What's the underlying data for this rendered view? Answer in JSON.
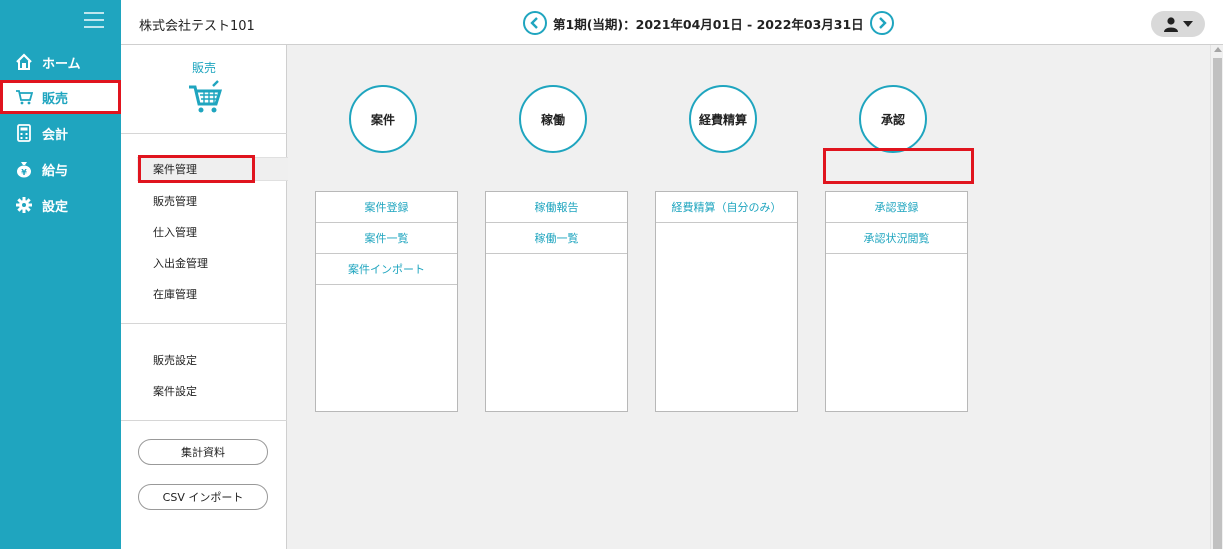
{
  "nav": {
    "items": [
      {
        "label": "ホーム",
        "icon": "home-icon"
      },
      {
        "label": "販売",
        "icon": "cart-icon"
      },
      {
        "label": "会計",
        "icon": "calculator-icon"
      },
      {
        "label": "給与",
        "icon": "money-bag-icon"
      },
      {
        "label": "設定",
        "icon": "gear-icon"
      }
    ]
  },
  "header": {
    "company": "株式会社テスト101",
    "period": "第1期(当期)：2021年04月01日 - 2022年03月31日"
  },
  "subpanel": {
    "title": "販売",
    "group1": [
      "案件管理",
      "販売管理",
      "仕入管理",
      "入出金管理",
      "在庫管理"
    ],
    "group2": [
      "販売設定",
      "案件設定"
    ],
    "buttons": [
      "集計資料",
      "CSV インポート"
    ]
  },
  "cards": [
    {
      "title": "案件",
      "rows": [
        "案件登録",
        "案件一覧",
        "案件インポート"
      ]
    },
    {
      "title": "稼働",
      "rows": [
        "稼働報告",
        "稼働一覧"
      ]
    },
    {
      "title": "経費精算",
      "rows": [
        "経費精算（自分のみ）"
      ]
    },
    {
      "title": "承認",
      "rows": [
        "承認登録",
        "承認状況閲覧"
      ]
    }
  ],
  "colors": {
    "accent": "#1fa5bf",
    "highlight": "#e0141e"
  }
}
